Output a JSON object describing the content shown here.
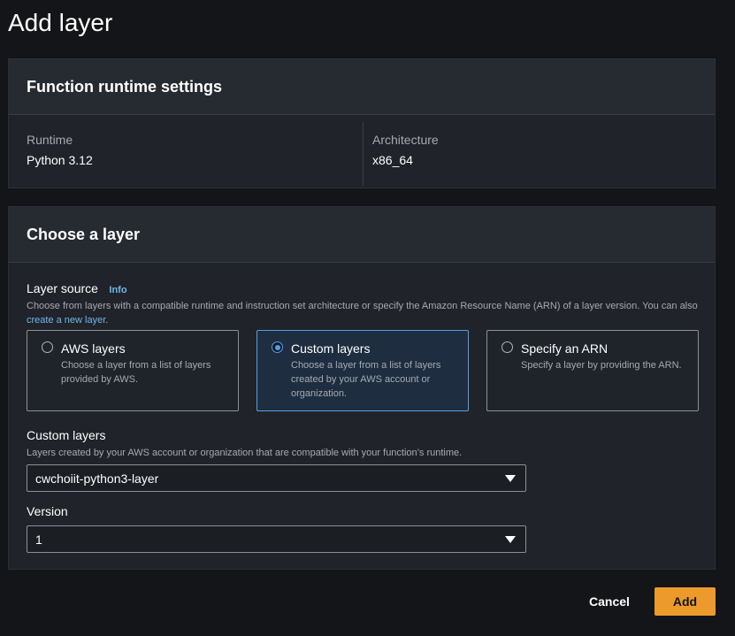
{
  "page": {
    "title": "Add layer"
  },
  "runtime_panel": {
    "header": "Function runtime settings",
    "runtime_label": "Runtime",
    "runtime_value": "Python 3.12",
    "arch_label": "Architecture",
    "arch_value": "x86_64"
  },
  "layer_panel": {
    "header": "Choose a layer",
    "source_label": "Layer source",
    "info": "Info",
    "source_desc": "Choose from layers with a compatible runtime and instruction set architecture or specify the Amazon Resource Name (ARN) of a layer version. You can also ",
    "source_link": "create a new layer",
    "source_desc_end": ".",
    "options": [
      {
        "title": "AWS layers",
        "desc": "Choose a layer from a list of layers provided by AWS.",
        "selected": false
      },
      {
        "title": "Custom layers",
        "desc": "Choose a layer from a list of layers created by your AWS account or organization.",
        "selected": true
      },
      {
        "title": "Specify an ARN",
        "desc": "Specify a layer by providing the ARN.",
        "selected": false
      }
    ],
    "custom_label": "Custom layers",
    "custom_desc": "Layers created by your AWS account or organization that are compatible with your function’s runtime.",
    "custom_value": "cwchoiit-python3-layer",
    "version_label": "Version",
    "version_value": "1"
  },
  "footer": {
    "cancel": "Cancel",
    "add": "Add"
  },
  "colors": {
    "accent": "#539fe5",
    "primary_button": "#ec9a2b",
    "link": "#6fb7ee"
  }
}
